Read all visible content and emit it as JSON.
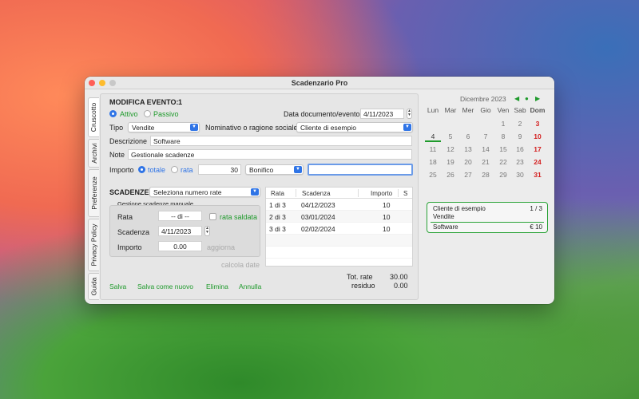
{
  "window": {
    "title": "Scadenzario Pro"
  },
  "sidetabs": [
    "Cruscotto",
    "Archivi",
    "Preferenze",
    "Privacy Policy",
    "Guida"
  ],
  "form": {
    "heading": "MODIFICA EVENTO:",
    "event_number": "1",
    "radio_attivo": "Attivo",
    "radio_passivo": "Passivo",
    "data_label": "Data documento/evento",
    "data_value": "4/11/2023",
    "tipo_label": "Tipo",
    "tipo_value": "Vendite",
    "nominativo_label": "Nominativo o ragione sociale",
    "nominativo_value": "Cliente di esempio",
    "descrizione_label": "Descrizione",
    "descrizione_value": "Software",
    "note_label": "Note",
    "note_value": "Gestionale scadenze",
    "importo_label": "Importo",
    "radio_totale": "totale",
    "radio_rata": "rata",
    "importo_value": "30",
    "pagamento_value": "Bonifico",
    "extra_value": ""
  },
  "scadenze": {
    "label": "SCADENZE",
    "select_value": "Seleziona numero rate",
    "group_title": "Gestione scadenze manuale",
    "rata_label": "Rata",
    "rata_value": "-- di --",
    "saldata_label": "rata saldata",
    "scadenza_label": "Scadenza",
    "scadenza_value": "4/11/2023",
    "importo_label": "Importo",
    "importo_value": "0.00",
    "aggiorna": "aggiorna",
    "calcola": "calcola date"
  },
  "table": {
    "columns": [
      "Rata",
      "Scadenza",
      "Importo",
      "S"
    ],
    "rows": [
      {
        "rata": "1 di 3",
        "scadenza": "04/12/2023",
        "importo": "10"
      },
      {
        "rata": "2 di 3",
        "scadenza": "03/01/2024",
        "importo": "10"
      },
      {
        "rata": "3 di 3",
        "scadenza": "02/02/2024",
        "importo": "10"
      }
    ]
  },
  "totals": {
    "tot_label": "Tot. rate",
    "tot_value": "30.00",
    "residuo_label": "residuo",
    "residuo_value": "0.00"
  },
  "actions": {
    "salva": "Salva",
    "salva_nuovo": "Salva come nuovo",
    "elimina": "Elimina",
    "annulla": "Annulla"
  },
  "calendar": {
    "month": "Dicembre 2023",
    "weekdays": [
      "Lun",
      "Mar",
      "Mer",
      "Gio",
      "Ven",
      "Sab",
      "Dom"
    ],
    "weeks": [
      [
        "",
        "",
        "",
        "",
        "1",
        "2",
        "3"
      ],
      [
        "4",
        "5",
        "6",
        "7",
        "8",
        "9",
        "10"
      ],
      [
        "11",
        "12",
        "13",
        "14",
        "15",
        "16",
        "17"
      ],
      [
        "18",
        "19",
        "20",
        "21",
        "22",
        "23",
        "24"
      ],
      [
        "25",
        "26",
        "27",
        "28",
        "29",
        "30",
        "31"
      ]
    ],
    "nav_prev": "◀",
    "nav_today": "●",
    "nav_next": "▶"
  },
  "card": {
    "client": "Cliente di esempio",
    "count": "1 / 3",
    "type": "Vendite",
    "item": "Software",
    "amount": "€ 10"
  },
  "colors": {
    "accent_green": "#1f9a2c",
    "accent_blue": "#2f74e6",
    "sunday_red": "#d42020"
  }
}
